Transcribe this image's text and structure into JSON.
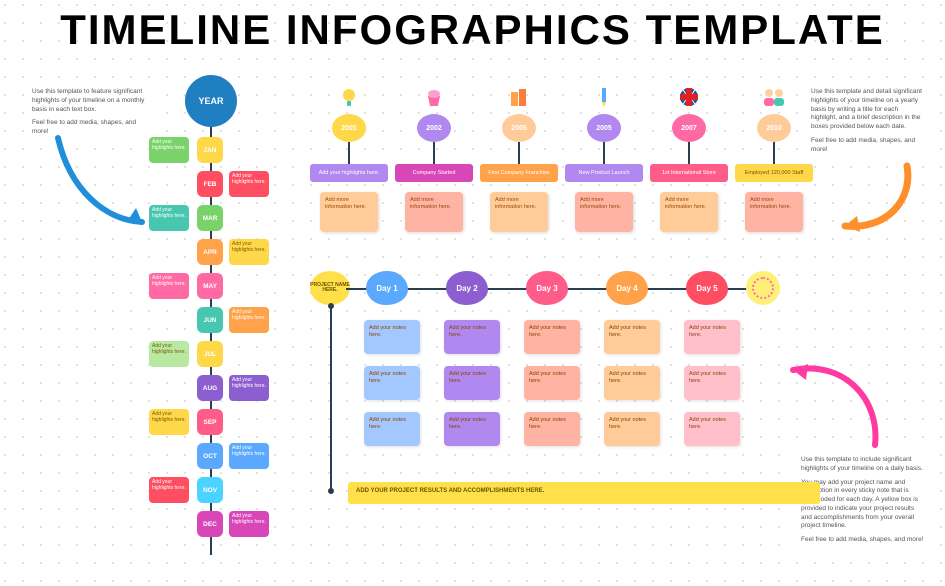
{
  "title": "TIMELINE INFOGRAPHICS TEMPLATE",
  "tips": {
    "left": [
      "Use this template to feature significant highlights of your timeline on a monthly basis in each text box.",
      "Feel free to add media, shapes, and more!"
    ],
    "right_top": [
      "Use this template and detail significant highlights of your timeline on a yearly basis by writing a title for each highlight, and a brief description in the boxes provided below each date.",
      "Feel free to add media, shapes, and more!"
    ],
    "right_bottom": [
      "Use this template to include significant highlights of your timeline on a daily basis.",
      "You may add your project name and description in every sticky note that is color-coded for each day. A yellow box is provided to indicate your project results and accomplishments from your overall project timeline.",
      "Feel free to add media, shapes, and more!"
    ]
  },
  "vtl": {
    "year_label": "YEAR",
    "note": "Add your highlights here.",
    "months": [
      {
        "abbr": "JAN",
        "side": "right",
        "node": "c-yellow",
        "box": "c-green"
      },
      {
        "abbr": "FEB",
        "side": "left",
        "node": "c-red",
        "box": "c-red"
      },
      {
        "abbr": "MAR",
        "side": "right",
        "node": "c-green",
        "box": "c-teal"
      },
      {
        "abbr": "APR",
        "side": "left",
        "node": "c-orange",
        "box": "c-yellow"
      },
      {
        "abbr": "MAY",
        "side": "right",
        "node": "c-pink",
        "box": "c-pink"
      },
      {
        "abbr": "JUN",
        "side": "left",
        "node": "c-teal",
        "box": "c-orange"
      },
      {
        "abbr": "JUL",
        "side": "right",
        "node": "c-yellow",
        "box": "c-lgreen"
      },
      {
        "abbr": "AUG",
        "side": "left",
        "node": "c-purple",
        "box": "c-purple"
      },
      {
        "abbr": "SEP",
        "side": "right",
        "node": "c-rose",
        "box": "c-yellow"
      },
      {
        "abbr": "OCT",
        "side": "left",
        "node": "c-blue",
        "box": "c-blue"
      },
      {
        "abbr": "NOV",
        "side": "right",
        "node": "c-cyan",
        "box": "c-red"
      },
      {
        "abbr": "DEC",
        "side": "left",
        "node": "c-mag",
        "box": "c-mag"
      }
    ]
  },
  "htl": {
    "info": "Add more information here.",
    "cols": [
      {
        "year": "2001",
        "hl": "Add your highlights here.",
        "bub": "c-yellow",
        "bar": "c-lpurp",
        "sticky": "c-lorange",
        "text": "light"
      },
      {
        "year": "2002",
        "hl": "Company Started",
        "bub": "c-lpurp",
        "bar": "c-mag",
        "sticky": "c-salmon",
        "text": "white"
      },
      {
        "year": "2005",
        "hl": "First Company Franchise",
        "bub": "c-lorange",
        "bar": "c-orange",
        "sticky": "c-lorange",
        "text": "white"
      },
      {
        "year": "2005",
        "hl": "New Product Launch",
        "bub": "c-lpurp",
        "bar": "c-lpurp",
        "sticky": "c-salmon",
        "text": "light"
      },
      {
        "year": "2007",
        "hl": "1st International Store",
        "bub": "c-pink",
        "bar": "c-rose",
        "sticky": "c-lorange",
        "text": "white"
      },
      {
        "year": "2010",
        "hl": "Employed 120,000 Staff",
        "bub": "c-lorange",
        "bar": "c-yellow",
        "sticky": "c-salmon",
        "text": "dark"
      }
    ]
  },
  "pg": {
    "project_label": "PROJECT NAME HERE.",
    "note": "Add your notes here.",
    "results": "ADD YOUR PROJECT RESULTS AND ACCOMPLISHMENTS HERE.",
    "days": [
      {
        "label": "Day 1",
        "bub": "c-blue",
        "notes": [
          "c-lblue",
          "c-lblue",
          "c-lblue"
        ]
      },
      {
        "label": "Day 2",
        "bub": "c-purple",
        "notes": [
          "c-lpurp",
          "c-lpurp",
          "c-lpurp"
        ]
      },
      {
        "label": "Day 3",
        "bub": "c-rose",
        "notes": [
          "c-salmon",
          "c-salmon",
          "c-salmon"
        ]
      },
      {
        "label": "Day 4",
        "bub": "c-orange",
        "notes": [
          "c-lorange",
          "c-lorange",
          "c-lorange"
        ]
      },
      {
        "label": "Day 5",
        "bub": "c-red",
        "notes": [
          "c-lrose",
          "c-lrose",
          "c-lrose"
        ]
      }
    ]
  }
}
